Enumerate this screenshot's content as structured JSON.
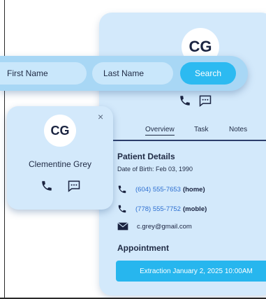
{
  "search": {
    "first_name_label": "First Name",
    "last_name_label": "Last Name",
    "search_label": "Search"
  },
  "mini_card": {
    "initials": "CG",
    "name": "Clementine Grey",
    "close": "×"
  },
  "patient_card": {
    "initials": "CG",
    "tabs": [
      {
        "label": "Overview",
        "active": true
      },
      {
        "label": "Task",
        "active": false
      },
      {
        "label": "Notes",
        "active": false
      }
    ],
    "details_title": "Patient Details",
    "dob": "Date of Birth: Feb 03, 1990",
    "phones": [
      {
        "number": "(604) 555-7653",
        "type": "(home)"
      },
      {
        "number": "(778) 555-7752",
        "type": "(moble)"
      }
    ],
    "email": "c.grey@gmail.com",
    "appointment_title": "Appointment",
    "appointment_button": "Extraction January 2, 2025 10:00AM"
  },
  "icons": {
    "phone": "phone-icon",
    "message": "message-icon",
    "email": "envelope-icon",
    "close": "close-icon"
  },
  "colors": {
    "card_bg": "#d3e9fb",
    "search_bar_bg": "#a8d7f5",
    "accent": "#27b6ee",
    "link": "#2d6fd1",
    "text": "#1f2a44"
  }
}
